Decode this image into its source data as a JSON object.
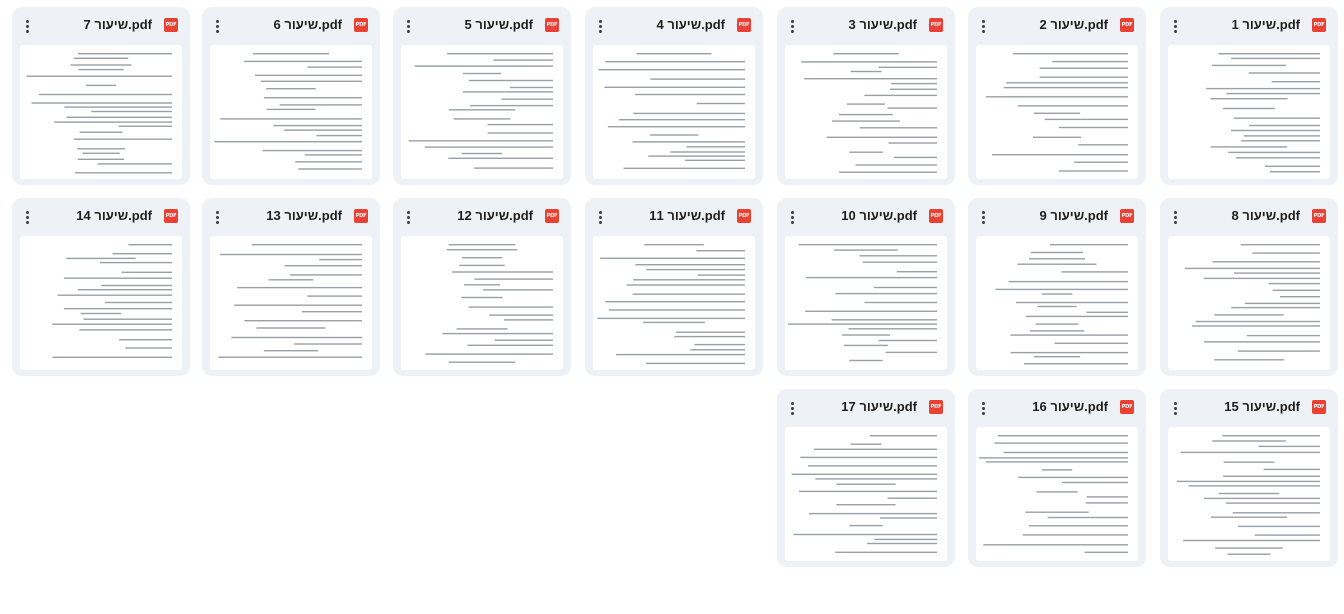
{
  "files": [
    {
      "title": "שיעור 1.pdf",
      "icon": "pdf-icon",
      "badge": "PDF"
    },
    {
      "title": "שיעור 2.pdf",
      "icon": "pdf-icon",
      "badge": "PDF"
    },
    {
      "title": "שיעור 3.pdf",
      "icon": "pdf-icon",
      "badge": "PDF"
    },
    {
      "title": "שיעור 4.pdf",
      "icon": "pdf-icon",
      "badge": "PDF"
    },
    {
      "title": "שיעור 5.pdf",
      "icon": "pdf-icon",
      "badge": "PDF"
    },
    {
      "title": "שיעור 6.pdf",
      "icon": "pdf-icon",
      "badge": "PDF"
    },
    {
      "title": "שיעור 7.pdf",
      "icon": "pdf-icon",
      "badge": "PDF"
    },
    {
      "title": "שיעור 8.pdf",
      "icon": "pdf-icon",
      "badge": "PDF"
    },
    {
      "title": "שיעור 9.pdf",
      "icon": "pdf-icon",
      "badge": "PDF"
    },
    {
      "title": "שיעור 10.pdf",
      "icon": "pdf-icon",
      "badge": "PDF"
    },
    {
      "title": "שיעור 11.pdf",
      "icon": "pdf-icon",
      "badge": "PDF"
    },
    {
      "title": "שיעור 12.pdf",
      "icon": "pdf-icon",
      "badge": "PDF"
    },
    {
      "title": "שיעור 13.pdf",
      "icon": "pdf-icon",
      "badge": "PDF"
    },
    {
      "title": "שיעור 14.pdf",
      "icon": "pdf-icon",
      "badge": "PDF"
    },
    {
      "title": "שיעור 15.pdf",
      "icon": "pdf-icon",
      "badge": "PDF"
    },
    {
      "title": "שיעור 16.pdf",
      "icon": "pdf-icon",
      "badge": "PDF"
    },
    {
      "title": "שיעור 17.pdf",
      "icon": "pdf-icon",
      "badge": "PDF"
    }
  ],
  "colors": {
    "card_bg": "#eef1f5",
    "pdf_red": "#e94235",
    "title_text": "#1f1f1f"
  }
}
